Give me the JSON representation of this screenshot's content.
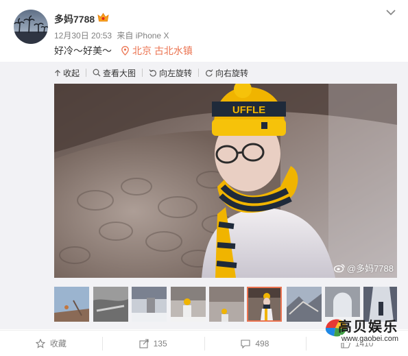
{
  "post": {
    "username": "多妈7788",
    "time": "12月30日 20:53",
    "source": "来自 iPhone X",
    "text": "好冷～好美～",
    "location": "北京 古北水镇"
  },
  "toolbar": {
    "collapse": "收起",
    "view_large": "查看大图",
    "rotate_left": "向左旋转",
    "rotate_right": "向右旋转"
  },
  "photo": {
    "watermark": "@多妈7788",
    "hat_text": "UFFLE",
    "thumbnail_count": 9,
    "selected_thumbnail_index": 6
  },
  "actions": {
    "favorite": "收藏",
    "repost": "135",
    "comment": "498",
    "like": "1410"
  },
  "brand": {
    "name": "高贝娱乐",
    "url": "www.gaobei.com"
  },
  "colors": {
    "accent": "#eb7350",
    "meta_gray": "#808080",
    "panel_bg": "#f2f2f5"
  }
}
